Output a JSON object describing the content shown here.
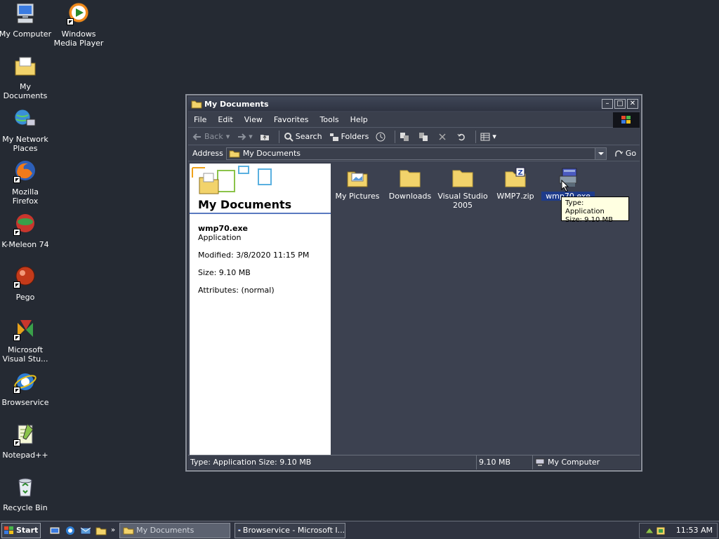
{
  "desktop": {
    "icons": [
      {
        "label": "My Computer"
      },
      {
        "label": "Windows Media Player"
      },
      {
        "label": "My Documents"
      },
      {
        "label": "My Network Places"
      },
      {
        "label": "Mozilla Firefox"
      },
      {
        "label": "K-Meleon 74"
      },
      {
        "label": "Pego"
      },
      {
        "label": "Microsoft Visual Stu..."
      },
      {
        "label": "Browservice"
      },
      {
        "label": "Notepad++"
      },
      {
        "label": "Recycle Bin"
      }
    ]
  },
  "window": {
    "title": "My Documents",
    "menu": [
      "File",
      "Edit",
      "View",
      "Favorites",
      "Tools",
      "Help"
    ],
    "toolbar": {
      "back": "Back",
      "search": "Search",
      "folders": "Folders"
    },
    "address": {
      "label": "Address",
      "value": "My Documents",
      "go": "Go"
    },
    "left_pane": {
      "title": "My Documents",
      "file_name": "wmp70.exe",
      "file_type": "Application",
      "modified": "Modified: 3/8/2020 11:15 PM",
      "size": "Size: 9.10 MB",
      "attributes": "Attributes: (normal)"
    },
    "files": [
      {
        "label": "My Pictures"
      },
      {
        "label": "Downloads"
      },
      {
        "label": "Visual Studio 2005"
      },
      {
        "label": "WMP7.zip"
      },
      {
        "label": "wmp70.exe"
      }
    ],
    "tooltip": {
      "line1": "Type: Application",
      "line2": "Size: 9.10 MB"
    },
    "status": {
      "info": "Type: Application Size: 9.10 MB",
      "size": "9.10 MB",
      "zone": "My Computer"
    }
  },
  "taskbar": {
    "start": "Start",
    "tasks": [
      {
        "label": "My Documents"
      },
      {
        "label": "Browservice - Microsoft I..."
      }
    ],
    "clock": "11:53 AM"
  },
  "colors": {
    "desktop": "#252a33",
    "window_bg": "#3c4150",
    "selection": "#1e3b8a",
    "tooltip_bg": "#ffffe1"
  }
}
